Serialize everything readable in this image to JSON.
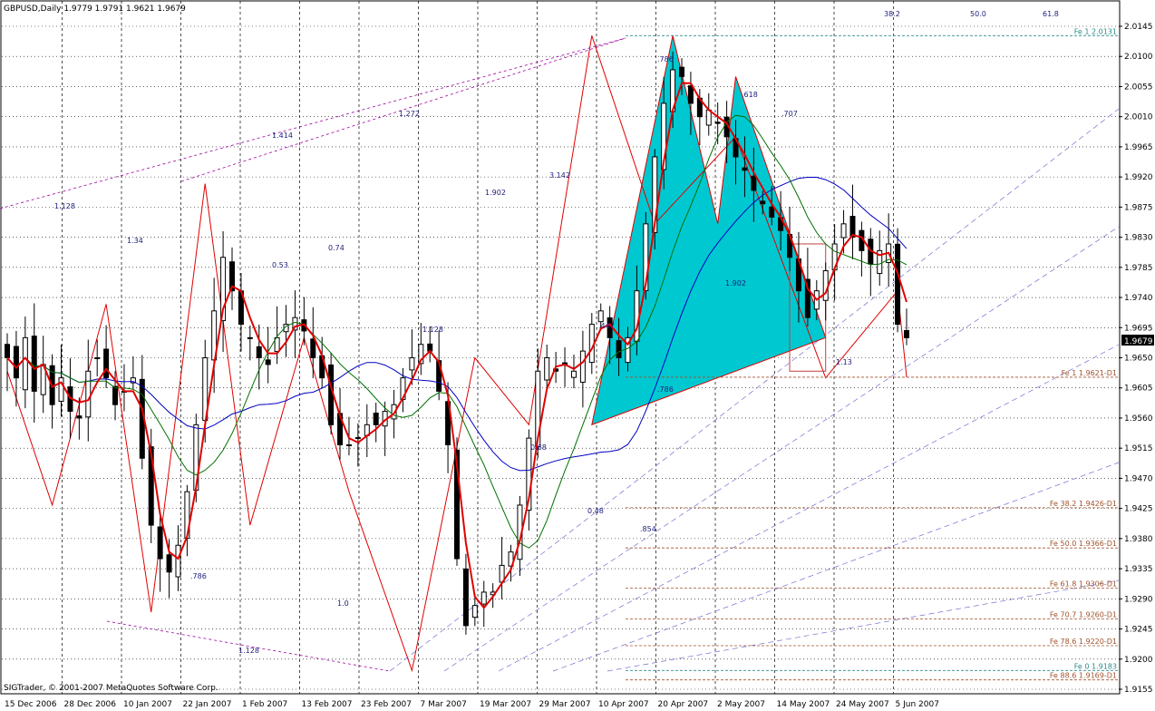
{
  "chart_data": {
    "type": "candlestick",
    "title": "GBPUSD,Daily",
    "ohlc": "1.9779 1.9791 1.9621 1.9679",
    "last_price": "1.9679",
    "copyright": "SIGTrader, © 2001-2007 MetaQuotes Software Corp.",
    "y_ticks": [
      "2.0145",
      "2.0100",
      "2.0055",
      "2.0010",
      "1.9965",
      "1.9920",
      "1.9875",
      "1.9830",
      "1.9785",
      "1.9740",
      "1.9695",
      "1.9650",
      "1.9605",
      "1.9560",
      "1.9515",
      "1.9470",
      "1.9425",
      "1.9380",
      "1.9335",
      "1.9290",
      "1.9245",
      "1.9200",
      "1.9155"
    ],
    "ylim": [
      1.9155,
      2.0145
    ],
    "x_ticks": [
      "15 Dec 2006",
      "28 Dec 2006",
      "10 Jan 2007",
      "22 Jan 2007",
      "1 Feb 2007",
      "13 Feb 2007",
      "23 Feb 2007",
      "7 Mar 2007",
      "19 Mar 2007",
      "29 Mar 2007",
      "10 Apr 2007",
      "20 Apr 2007",
      "2 May 2007",
      "14 May 2007",
      "24 May 2007",
      "5 Jun 2007"
    ],
    "fib_labels": [
      {
        "text": "Fe 1 2.0131",
        "price": 2.0131,
        "color": "#2a8a8a"
      },
      {
        "text": "Fe 1 1.9621-D1",
        "price": 1.9621,
        "color": "#a0522d"
      },
      {
        "text": "Fe 38.2 1.9426-D1",
        "price": 1.9426,
        "color": "#a0522d"
      },
      {
        "text": "Fe 50.0 1.9366-D1",
        "price": 1.9366,
        "color": "#a0522d"
      },
      {
        "text": "Fe 61.8 1.9306-D1",
        "price": 1.9306,
        "color": "#a0522d"
      },
      {
        "text": "Fe 70.7 1.9260-D1",
        "price": 1.926,
        "color": "#a0522d"
      },
      {
        "text": "Fe 78.6 1.9220-D1",
        "price": 1.922,
        "color": "#a0522d"
      },
      {
        "text": "Fe 88.6 1.9169-D1",
        "price": 1.9169,
        "color": "#a0522d"
      },
      {
        "text": "Fe 0 1.9183",
        "price": 1.9183,
        "color": "#2a8a8a"
      }
    ],
    "ratio_labels": [
      "1.128",
      "1.34",
      "0.53",
      "0.74",
      "1.414",
      "1.272",
      "1.128",
      "1.902",
      "3.142",
      ".786",
      ".618",
      ".707",
      "1.902",
      ".447",
      "0.68",
      "0.48",
      ".854",
      ".786",
      "1.13",
      ".786",
      "1.128",
      "1.0",
      "38.2",
      "50.0",
      "61.8"
    ],
    "close_series": [
      1.965,
      1.962,
      1.968,
      1.96,
      1.964,
      1.958,
      1.962,
      1.957,
      1.956,
      1.963,
      1.965,
      1.962,
      1.958,
      1.96,
      1.962,
      1.95,
      1.94,
      1.935,
      1.933,
      1.937,
      1.945,
      1.955,
      1.965,
      1.972,
      1.98,
      1.975,
      1.97,
      1.968,
      1.965,
      1.964,
      1.968,
      1.97,
      1.971,
      1.969,
      1.965,
      1.962,
      1.955,
      1.952,
      1.952,
      1.953,
      1.955,
      1.955,
      1.957,
      1.958,
      1.962,
      1.965,
      1.967,
      1.966,
      1.96,
      1.952,
      1.935,
      1.925,
      1.928,
      1.93,
      1.93,
      1.934,
      1.936,
      1.943,
      1.953,
      1.963,
      1.965,
      1.963,
      1.964,
      1.963,
      1.966,
      1.97,
      1.972,
      1.968,
      1.965,
      1.968,
      1.975,
      1.985,
      1.995,
      2.003,
      2.008,
      2.007,
      2.003,
      2.001,
      2.002,
      2.0,
      1.998,
      1.995,
      1.993,
      1.99,
      1.988,
      1.986,
      1.984,
      1.98,
      1.975,
      1.971,
      1.975,
      1.978,
      1.982,
      1.985,
      1.983,
      1.981,
      1.979,
      1.981,
      1.982,
      1.97,
      1.968
    ]
  },
  "ui": {
    "bg": "#ffffff",
    "up": "#ffffff",
    "down": "#000000",
    "ma_fast": "#e00000",
    "ma_mid": "#007000",
    "ma_slow": "#0000c0",
    "zigzag": "#e00000",
    "pattern_fill": "#00c8d0",
    "fib_dash": "#a0522d",
    "grid": "#000000"
  }
}
